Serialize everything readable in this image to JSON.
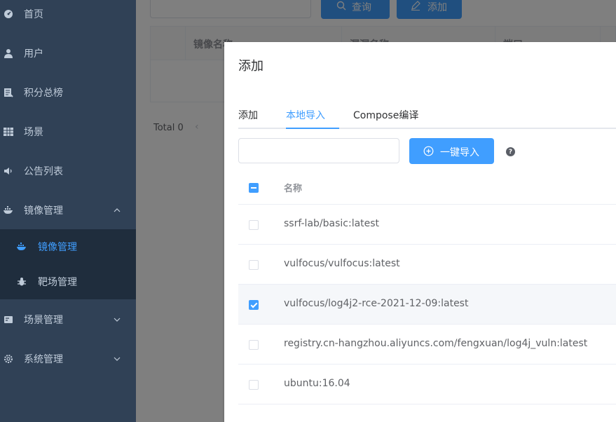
{
  "sidebar": {
    "items": [
      {
        "label": "首页",
        "icon": "dashboard-icon"
      },
      {
        "label": "用户",
        "icon": "user-icon"
      },
      {
        "label": "积分总榜",
        "icon": "rank-icon"
      },
      {
        "label": "场景",
        "icon": "grid-icon"
      },
      {
        "label": "公告列表",
        "icon": "speaker-icon"
      },
      {
        "label": "镜像管理",
        "icon": "docker-icon"
      },
      {
        "label": "场景管理",
        "icon": "scene-icon"
      },
      {
        "label": "系统管理",
        "icon": "gear-icon"
      }
    ],
    "submenu": [
      {
        "label": "镜像管理",
        "icon": "docker-icon"
      },
      {
        "label": "靶场管理",
        "icon": "bug-icon"
      }
    ]
  },
  "background": {
    "search_label": "查询",
    "add_label": "添加",
    "table_headers": [
      "镜像名称",
      "漏洞名称",
      "端口"
    ],
    "total": "Total 0"
  },
  "dialog": {
    "title": "添加",
    "tabs": [
      "添加",
      "本地导入",
      "Compose编译"
    ],
    "active_tab": 1,
    "import_button": "一键导入",
    "help": "?",
    "table": {
      "header": "名称",
      "rows": [
        {
          "name": "ssrf-lab/basic:latest",
          "checked": false
        },
        {
          "name": "vulfocus/vulfocus:latest",
          "checked": false
        },
        {
          "name": "vulfocus/log4j2-rce-2021-12-09:latest",
          "checked": true
        },
        {
          "name": "registry.cn-hangzhou.aliyuncs.com/fengxuan/log4j_vuln:latest",
          "checked": false
        },
        {
          "name": "ubuntu:16.04",
          "checked": false
        }
      ]
    }
  },
  "colors": {
    "sidebar": "#304156",
    "submenu": "#1f2d3d",
    "accent": "#409eff",
    "menu_text": "#bfcbd9"
  }
}
